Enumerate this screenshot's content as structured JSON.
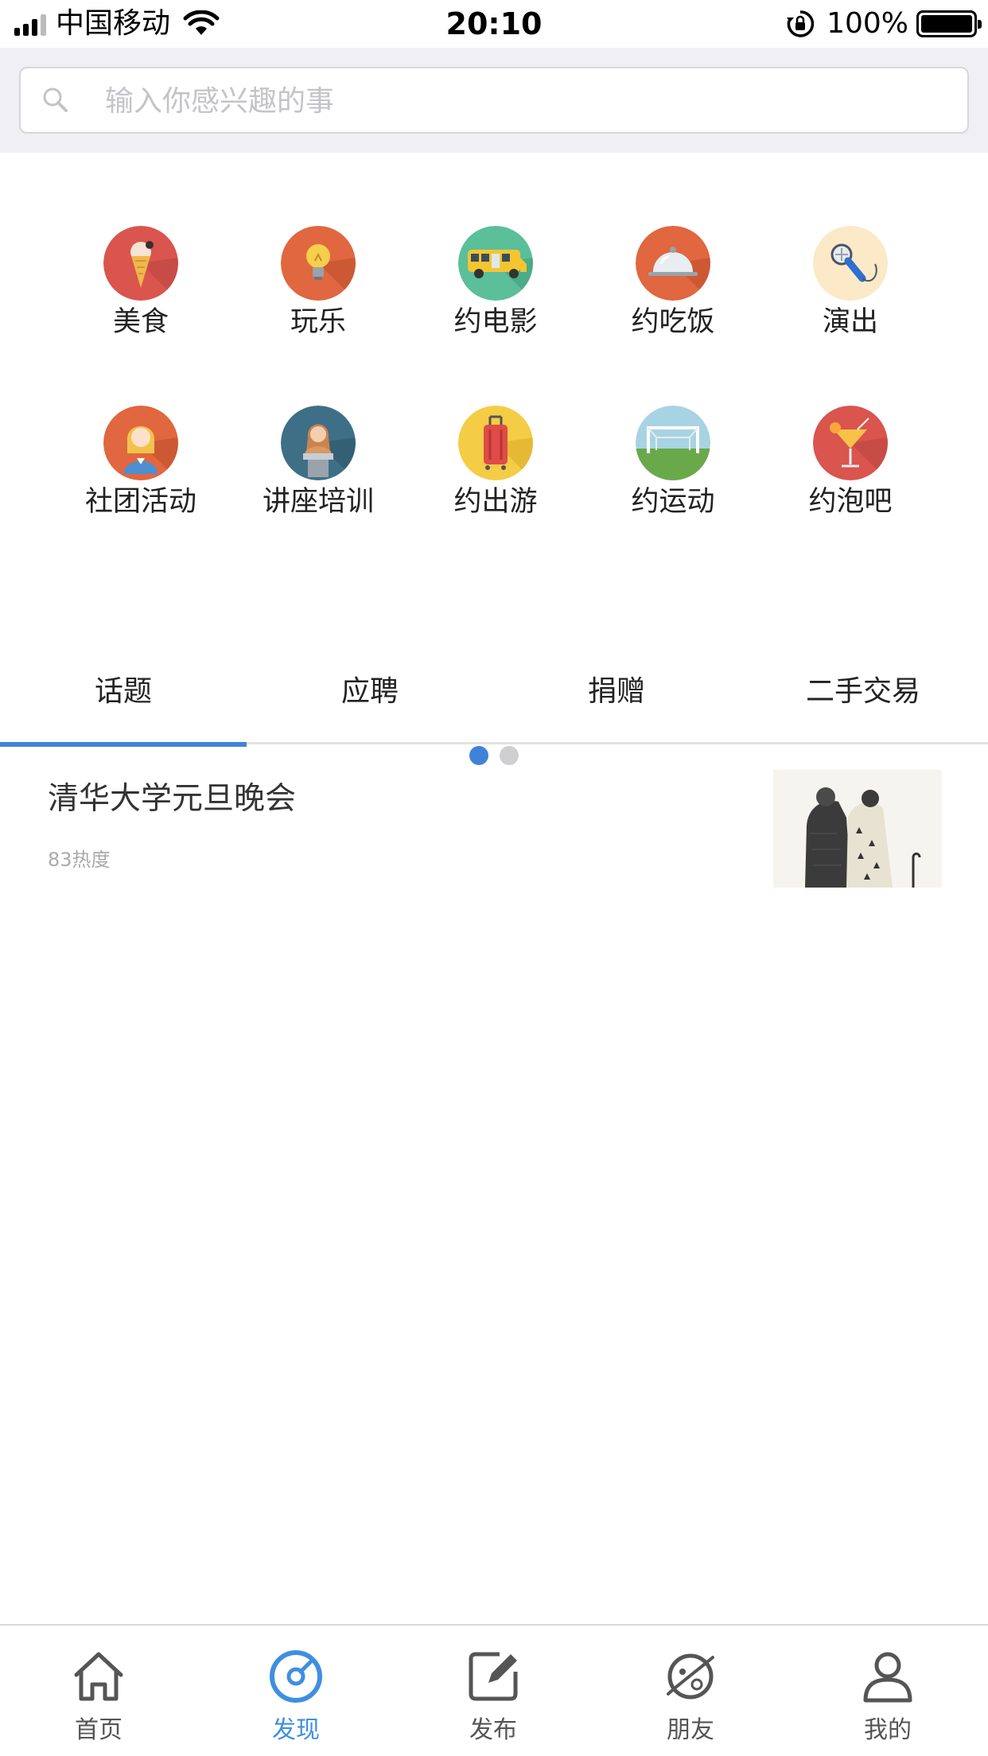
{
  "status_bar": {
    "carrier": "中国移动",
    "time": "20:10",
    "battery": "100%",
    "icons": [
      "signal-icon",
      "wifi-icon",
      "rotation-lock-icon",
      "battery-icon"
    ]
  },
  "search": {
    "placeholder": "输入你感兴趣的事",
    "value": ""
  },
  "categories": [
    {
      "label": "美食",
      "icon": "ice-cream-icon"
    },
    {
      "label": "玩乐",
      "icon": "lightbulb-icon"
    },
    {
      "label": "约电影",
      "icon": "bus-icon"
    },
    {
      "label": "约吃饭",
      "icon": "cloche-icon"
    },
    {
      "label": "演出",
      "icon": "microphone-icon"
    },
    {
      "label": "社团活动",
      "icon": "woman-icon"
    },
    {
      "label": "讲座培训",
      "icon": "speaker-podium-icon"
    },
    {
      "label": "约出游",
      "icon": "luggage-icon"
    },
    {
      "label": "约运动",
      "icon": "soccer-goal-icon"
    },
    {
      "label": "约泡吧",
      "icon": "cocktail-icon"
    }
  ],
  "pager": {
    "pages": 2,
    "current": 1
  },
  "tabs": [
    {
      "label": "话题",
      "active": true
    },
    {
      "label": "应聘",
      "active": false
    },
    {
      "label": "捐赠",
      "active": false
    },
    {
      "label": "二手交易",
      "active": false
    }
  ],
  "topics": [
    {
      "title": "清华大学元旦晚会",
      "heat": "83热度"
    }
  ],
  "tabbar": [
    {
      "label": "首页",
      "icon": "home-icon",
      "active": false
    },
    {
      "label": "发现",
      "icon": "compass-icon",
      "active": true
    },
    {
      "label": "发布",
      "icon": "edit-icon",
      "active": false
    },
    {
      "label": "朋友",
      "icon": "planet-icon",
      "active": false
    },
    {
      "label": "我的",
      "icon": "user-icon",
      "active": false
    }
  ],
  "colors": {
    "accent": "#3f83d8",
    "search_bg": "#efeff4",
    "tabbar_active": "#3f8fe0"
  }
}
